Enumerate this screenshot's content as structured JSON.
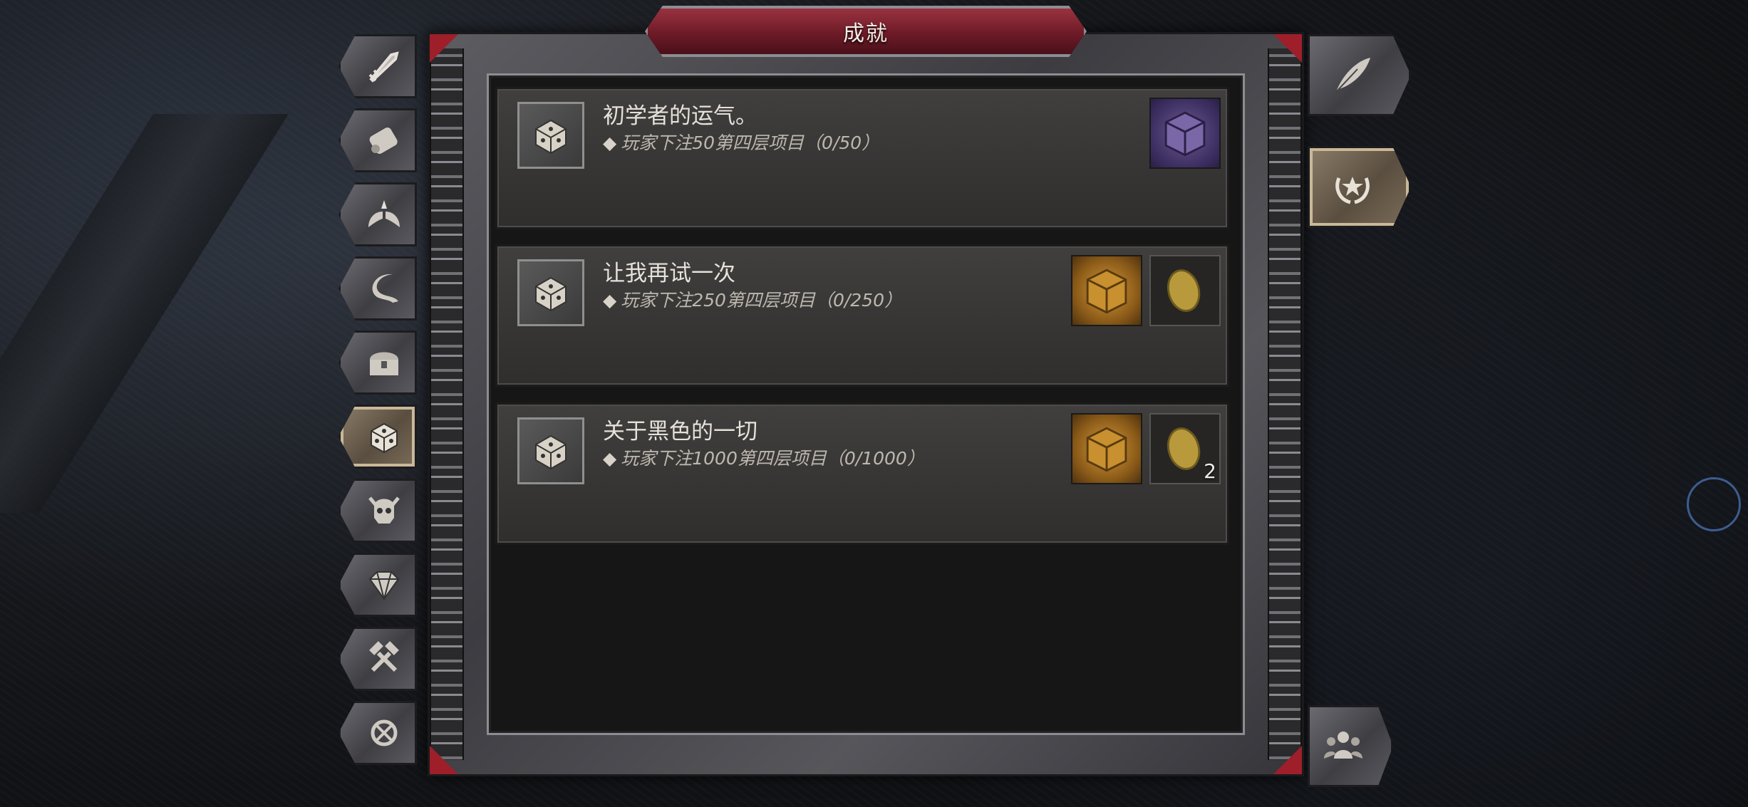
{
  "title": "成就",
  "left_tabs": [
    {
      "icon": "sword-icon",
      "active": false
    },
    {
      "icon": "scroll-icon",
      "active": false
    },
    {
      "icon": "wings-icon",
      "active": false
    },
    {
      "icon": "horn-icon",
      "active": false
    },
    {
      "icon": "chest-icon",
      "active": false
    },
    {
      "icon": "dice-icon",
      "active": true
    },
    {
      "icon": "demon-skull-icon",
      "active": false
    },
    {
      "icon": "gem-icon",
      "active": false
    },
    {
      "icon": "hammer-icon",
      "active": false
    },
    {
      "icon": "rune-icon",
      "active": false
    }
  ],
  "right_tabs": [
    {
      "icon": "quill-icon",
      "active": false
    },
    {
      "icon": "laurel-star-icon",
      "active": true
    },
    {
      "icon": "party-icon",
      "active": false
    }
  ],
  "achievements": [
    {
      "title": "初学者的运气。",
      "bullet": "◆",
      "description": "玩家下注50第四层项目（0/50）",
      "icon": "dice-icon",
      "rewards": [
        {
          "type": "purple-cube",
          "icon": "purple-cube-icon",
          "count": ""
        }
      ]
    },
    {
      "title": "让我再试一次",
      "bullet": "◆",
      "description": "玩家下注250第四层项目（0/250）",
      "icon": "dice-icon",
      "rewards": [
        {
          "type": "gold-cube",
          "icon": "gold-cube-icon",
          "count": ""
        },
        {
          "type": "gold-coin",
          "icon": "gold-coin-icon",
          "count": ""
        }
      ]
    },
    {
      "title": "关于黑色的一切",
      "bullet": "◆",
      "description": "玩家下注1000第四层项目（0/1000）",
      "icon": "dice-icon",
      "rewards": [
        {
          "type": "gold-cube",
          "icon": "gold-cube-icon",
          "count": ""
        },
        {
          "type": "gold-coin",
          "icon": "gold-coin-icon",
          "count": "2"
        }
      ]
    }
  ],
  "colors": {
    "accent_red": "#9e1f2a",
    "active_tab": "#c9b899",
    "panel": "#161616"
  }
}
